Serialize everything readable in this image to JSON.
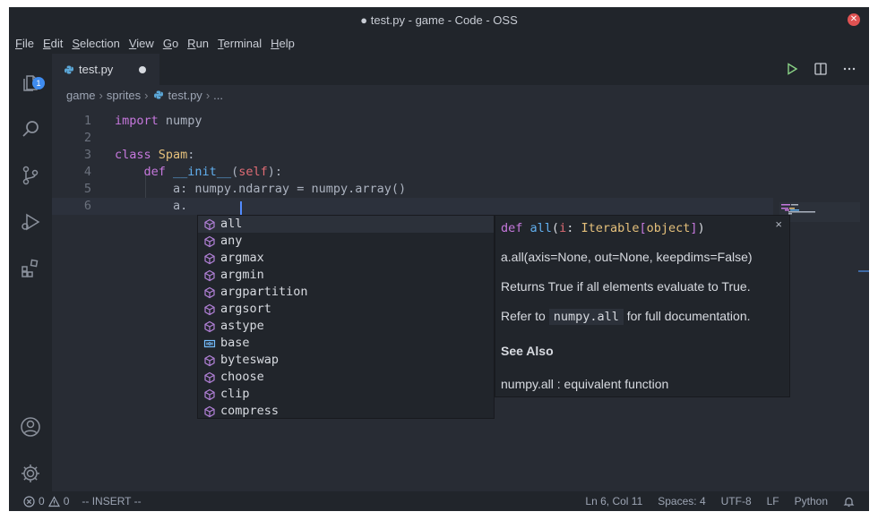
{
  "window": {
    "title": "● test.py - game - Code - OSS",
    "close_glyph": "✕"
  },
  "menu": [
    "File",
    "Edit",
    "Selection",
    "View",
    "Go",
    "Run",
    "Terminal",
    "Help"
  ],
  "activity_bar": {
    "explorer_badge": "1",
    "icons": [
      "files-icon",
      "search-icon",
      "source-control-icon",
      "run-debug-icon",
      "extensions-icon",
      "account-icon",
      "settings-gear-icon"
    ]
  },
  "tab": {
    "label": "test.py",
    "dirty": true
  },
  "breadcrumb": [
    "game",
    "sprites",
    "test.py",
    "..."
  ],
  "editor": {
    "line_numbers": [
      "1",
      "2",
      "3",
      "4",
      "5",
      "6"
    ],
    "lines": [
      [
        {
          "t": "import",
          "c": "kw"
        },
        {
          "t": " numpy",
          "c": ""
        }
      ],
      [],
      [
        {
          "t": "class",
          "c": "kw"
        },
        {
          "t": " ",
          "c": ""
        },
        {
          "t": "Spam",
          "c": "cls"
        },
        {
          "t": ":",
          "c": ""
        }
      ],
      [
        {
          "t": "    def",
          "c": "kw"
        },
        {
          "t": " ",
          "c": ""
        },
        {
          "t": "__init__",
          "c": "fn"
        },
        {
          "t": "(",
          "c": ""
        },
        {
          "t": "self",
          "c": "self"
        },
        {
          "t": "):",
          "c": ""
        }
      ],
      [
        {
          "t": "        a: numpy.ndarray = numpy.array()",
          "c": ""
        }
      ],
      [
        {
          "t": "        a.",
          "c": ""
        }
      ]
    ]
  },
  "suggestions": [
    {
      "label": "all",
      "kind": "method",
      "selected": true
    },
    {
      "label": "any",
      "kind": "method"
    },
    {
      "label": "argmax",
      "kind": "method"
    },
    {
      "label": "argmin",
      "kind": "method"
    },
    {
      "label": "argpartition",
      "kind": "method"
    },
    {
      "label": "argsort",
      "kind": "method"
    },
    {
      "label": "astype",
      "kind": "method"
    },
    {
      "label": "base",
      "kind": "field"
    },
    {
      "label": "byteswap",
      "kind": "method"
    },
    {
      "label": "choose",
      "kind": "method"
    },
    {
      "label": "clip",
      "kind": "method"
    },
    {
      "label": "compress",
      "kind": "method"
    }
  ],
  "details": {
    "sig_def": "def",
    "sig_name": "all",
    "sig_open": "(",
    "sig_param": "i",
    "sig_colon": ": ",
    "sig_type": "Iterable",
    "sig_bracket_open": "[",
    "sig_type_inner": "object",
    "sig_bracket_close": "]",
    "sig_close": ")",
    "call": "a.all(axis=None, out=None, keepdims=False)",
    "returns": "Returns True if all elements evaluate to True.",
    "refer_before": "Refer to ",
    "refer_code": "numpy.all",
    "refer_after": " for full documentation.",
    "see_also": "See Also",
    "see_also_item": "numpy.all : equivalent function",
    "close": "×"
  },
  "status": {
    "errors": "0",
    "warnings": "0",
    "mode": "-- INSERT --",
    "position": "Ln 6, Col 11",
    "spaces": "Spaces: 4",
    "encoding": "UTF-8",
    "eol": "LF",
    "language": "Python"
  },
  "colors": {
    "keyword": "#c678dd",
    "class": "#e5c07b",
    "function": "#61afef",
    "self": "#e06c75",
    "badge": "#3f8cf0",
    "method_icon": "#b180d7",
    "field_icon": "#75beff"
  }
}
